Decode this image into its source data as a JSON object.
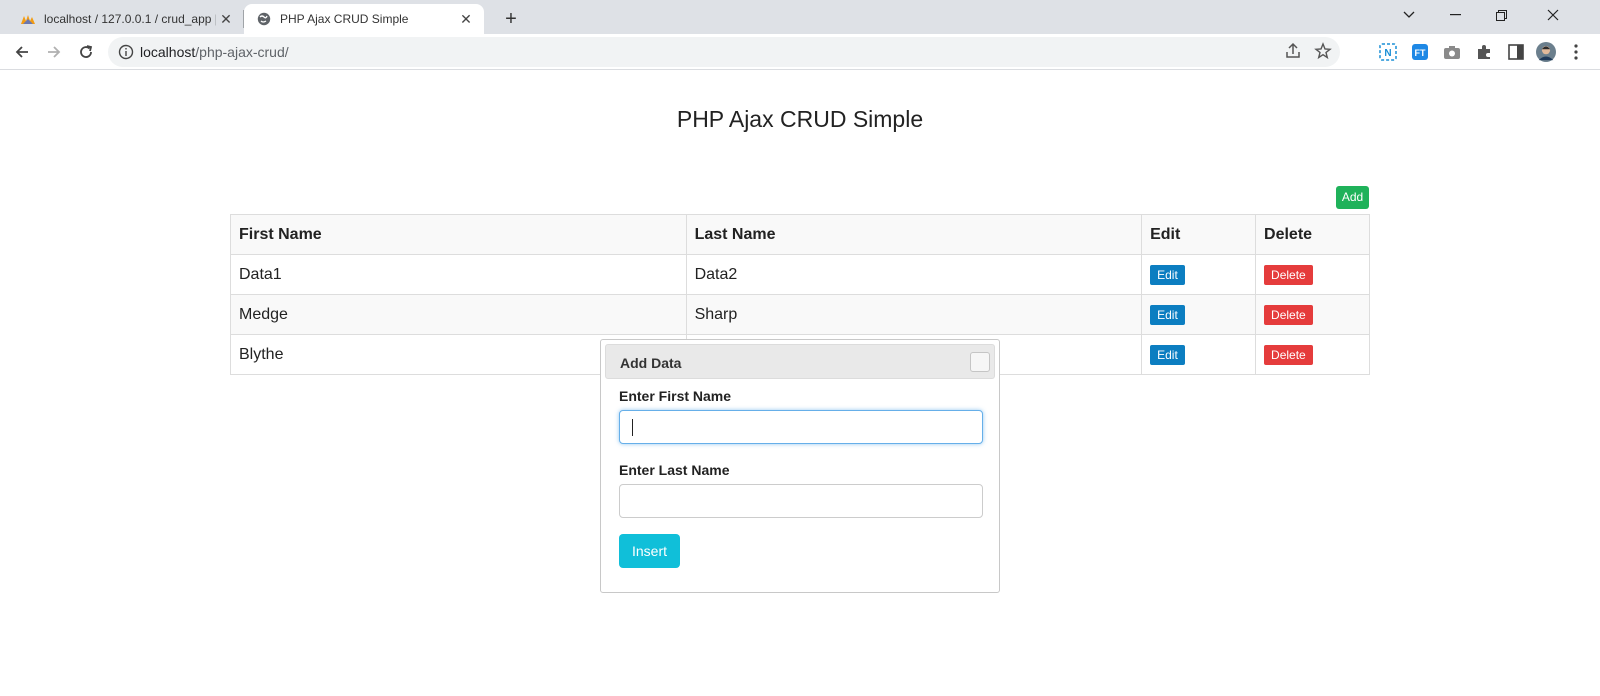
{
  "browser": {
    "tabs": [
      {
        "title": "localhost / 127.0.0.1 / crud_app | ...",
        "favicon": "phpmyadmin-icon",
        "active": false
      },
      {
        "title": "PHP Ajax CRUD Simple",
        "favicon": "globe-icon",
        "active": true
      }
    ],
    "url_host": "localhost",
    "url_path": "/php-ajax-crud/",
    "extensions": [
      "bookmark-n-icon",
      "translate-icon",
      "camera-icon",
      "puzzle-icon",
      "sidepanel-icon",
      "profile-avatar"
    ]
  },
  "page": {
    "title": "PHP Ajax CRUD Simple",
    "add_label": "Add",
    "table": {
      "headers": [
        "First Name",
        "Last Name",
        "Edit",
        "Delete"
      ],
      "rows": [
        {
          "first": "Data1",
          "last": "Data2"
        },
        {
          "first": "Medge",
          "last": "Sharp"
        },
        {
          "first": "Blythe",
          "last": ""
        }
      ],
      "edit_label": "Edit",
      "delete_label": "Delete"
    }
  },
  "dialog": {
    "title": "Add Data",
    "first_label": "Enter First Name",
    "first_value": "",
    "last_label": "Enter Last Name",
    "last_value": "",
    "insert_label": "Insert"
  },
  "colors": {
    "add": "#1fb25a",
    "edit": "#0c7ec1",
    "delete": "#e53c3c",
    "insert": "#10bfd9"
  }
}
